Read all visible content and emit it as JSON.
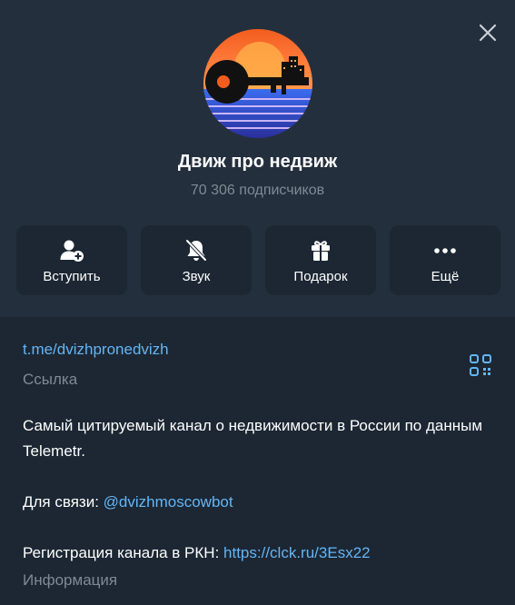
{
  "header": {
    "close_icon": "close-icon"
  },
  "channel": {
    "name": "Движ про недвиж",
    "subscribers": "70 306 подписчиков"
  },
  "actions": [
    {
      "label": "Вступить",
      "icon": "add-user-icon"
    },
    {
      "label": "Звук",
      "icon": "bell-muted-icon"
    },
    {
      "label": "Подарок",
      "icon": "gift-icon"
    },
    {
      "label": "Ещё",
      "icon": "more-icon"
    }
  ],
  "info": {
    "link": "t.me/dvizhpronedvizh",
    "link_caption": "Ссылка",
    "description_line1": "Самый цитируемый канал о недвижимости в России по данным Telemetr.",
    "contact_prefix": "Для связи: ",
    "contact_handle": "@dvizhmoscowbot",
    "registration_prefix": "Регистрация канала в РКН: ",
    "registration_link": "https://clck.ru/3Esx22",
    "info_caption": "Информация"
  },
  "colors": {
    "header_bg": "#242f3d",
    "body_bg": "#1c2733",
    "button_bg": "#1c2733",
    "link": "#64b5f6",
    "muted": "#7f8a96"
  }
}
